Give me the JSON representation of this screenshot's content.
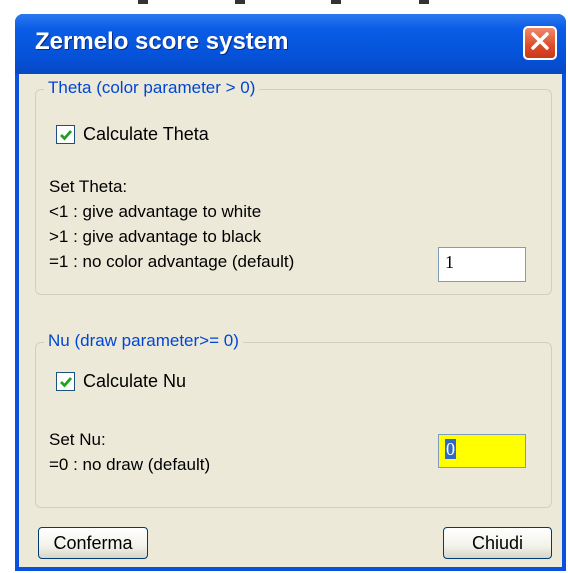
{
  "dialog": {
    "title": "Zermelo score system"
  },
  "theta_group": {
    "legend": "Theta (color parameter > 0)",
    "checkbox_label": "Calculate Theta",
    "checked": true,
    "instructions": [
      "Set Theta:",
      "<1 : give advantage to white",
      ">1 : give advantage to black",
      "=1 : no color advantage (default)"
    ],
    "value": "1"
  },
  "nu_group": {
    "legend": "Nu (draw parameter>= 0)",
    "checkbox_label": "Calculate Nu",
    "checked": true,
    "instructions": [
      "Set Nu:",
      "=0 : no draw (default)"
    ],
    "value": "0",
    "value_highlight_color": "#ffff00"
  },
  "buttons": {
    "confirm_label": "Conferma",
    "close_label": "Chiudi"
  },
  "colors": {
    "titlebar": "#0552d9",
    "group_legend": "#0046d5",
    "close_button": "#dd4a27"
  }
}
